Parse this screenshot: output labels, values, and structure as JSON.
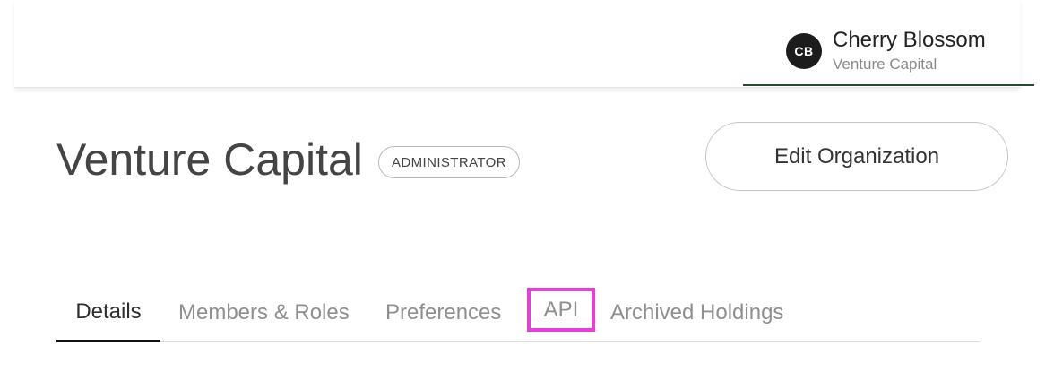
{
  "user": {
    "initials": "CB",
    "name": "Cherry Blossom",
    "org": "Venture Capital"
  },
  "org": {
    "title": "Venture Capital",
    "role_badge": "ADMINISTRATOR",
    "edit_label": "Edit Organization"
  },
  "tabs": [
    {
      "label": "Details",
      "active": true
    },
    {
      "label": "Members & Roles",
      "active": false
    },
    {
      "label": "Preferences",
      "active": false
    },
    {
      "label": "API",
      "active": false,
      "highlighted": true
    },
    {
      "label": "Archived Holdings",
      "active": false
    }
  ],
  "colors": {
    "highlight": "#e63fd6",
    "user_underline": "#284a33",
    "active_tab_underline": "#111111"
  }
}
